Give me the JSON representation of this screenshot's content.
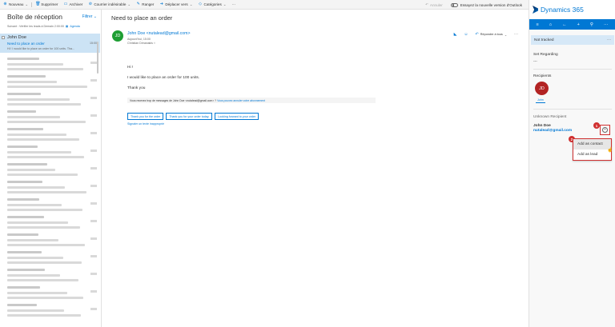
{
  "toolbar": {
    "new_label": "Nouveau",
    "delete_label": "Supprimer",
    "archive_label": "Archiver",
    "junk_label": "Courrier indésirable",
    "sweep_label": "Ranger",
    "move_label": "Déplacer vers",
    "categories_label": "Catégories",
    "more_label": "···",
    "undo_label": "Annuler",
    "try_label": "Essayez la nouvelle version d'Outlook"
  },
  "folder": {
    "title": "Boîte de réception",
    "filter_label": "Filtrer",
    "sub_prefix": "Suivant : Vérifier les leads à",
    "sub_time": "Demain 2:00:00",
    "sub_link": "Agenda"
  },
  "selected_mail": {
    "from": "John Doe",
    "subject": "Need to place an order",
    "time": "15:00",
    "preview": "Hi ! I would like to place an order for 100 units. Tha..."
  },
  "reading": {
    "subject": "Need to place an order",
    "avatar_initials": "JD",
    "sender": "John Doe <nutalead@gmail.com>",
    "meta": "Aujourd'hui, 15:00",
    "to": "Christian Dimanakis  ☓",
    "reply_all_label": "Répondre à tous",
    "body": [
      "Hi !",
      "I would like to place an order for 100 units.",
      "Thank you"
    ],
    "notice_text": "Vous recevez trop de messages de John Doe <nutalead@gmail.com> ?",
    "notice_link": "Vous pouvez annuler votre abonnement",
    "quick_replies": [
      "Thank you for the order",
      "Thank you for your order today.",
      "Looking forward to your order"
    ],
    "sign_link": "Signaler un texte inapproprié"
  },
  "panel": {
    "title": "Dynamics 365",
    "not_tracked": "Not tracked",
    "set_regarding_label": "Set Regarding",
    "set_regarding_value": "---",
    "recipients_label": "Recipients",
    "recipient_initials": "JD",
    "recipient_name": "John",
    "unknown_label": "Unknown Recipient",
    "unknown_name": "John Doe",
    "unknown_email": "nutalead@gmail.com",
    "menu": [
      "Add as contact",
      "Add as lead"
    ],
    "badge_1": "1",
    "badge_2": "2"
  },
  "colors": {
    "accent": "#0078d4",
    "selected_row": "#cce3f5",
    "callout_red": "#d03030",
    "sender_avatar": "#1e9e33",
    "recipient_avatar": "#b22323"
  }
}
